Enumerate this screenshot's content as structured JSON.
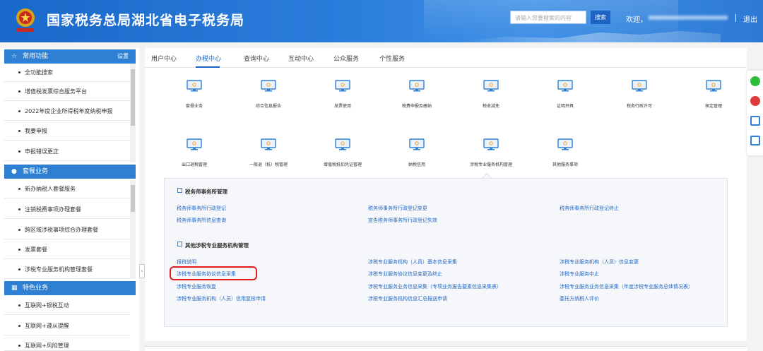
{
  "header": {
    "title": "国家税务总局湖北省电子税务局",
    "search_placeholder": "请输入您要搜索的内容",
    "search_button": "搜索",
    "welcome": "欢迎，",
    "logout": "退出"
  },
  "sidebar": {
    "sections": [
      {
        "title": "常用功能",
        "action": "设置",
        "items": [
          "全功能搜索",
          "增值税发票综合服务平台",
          "2022年度企业所得税年度纳税申报",
          "我要申报",
          "申报错误更正"
        ]
      },
      {
        "title": "套餐业务",
        "items": [
          "新办纳税人套餐服务",
          "注销税费事项办理套餐",
          "跨区域涉税事项综合办理套餐",
          "发票套餐",
          "涉税专业服务机构管理套餐"
        ]
      },
      {
        "title": "特色业务",
        "items": [
          "互联网+银税互动",
          "互联网+遵从提醒",
          "互联网+风险管理"
        ]
      }
    ]
  },
  "tabs": [
    "用户中心",
    "办税中心",
    "查询中心",
    "互动中心",
    "公众服务",
    "个性服务"
  ],
  "active_tab": "办税中心",
  "functions_row1": [
    "套餐业务",
    "综合信息报告",
    "发票使用",
    "税费申报及缴纳",
    "税收减免",
    "证明开具",
    "税务行政许可",
    "核定管理"
  ],
  "functions_row2": [
    "出口退税管理",
    "一般退（抵）税管理",
    "增值税抵扣凭证管理",
    "纳税信用",
    "涉税专业服务机构管理",
    "其他服务事项"
  ],
  "panel": {
    "group1": {
      "title": "税务师事务所管理",
      "links": [
        "税务师事务所行政登记",
        "税务师事务所行政登记变更",
        "税务师事务所行政登记终止",
        "税务师事务所信息查询",
        "宣告税务师事务所行政登记失效"
      ]
    },
    "group2": {
      "title": "其他涉税专业服务机构管理",
      "links": [
        "报税说明",
        "涉税专业服务机构（人员）基本信息采集",
        "涉税专业服务机构（人员）信息变更",
        "涉税专业服务协议信息采集",
        "涉税专业服务协议信息变更及终止",
        "涉税专业服务中止",
        "涉税专业服务恢复",
        "涉税专业服务业务信息采集（专项业务报告要素信息采集表）",
        "涉税专业服务业务信息采集（年度涉税专业服务总体情况表）",
        "涉税专业服务机构（人员）信用复核申请",
        "涉税专业服务机构信息汇总报送申请",
        "委托方纳税人评价"
      ]
    }
  },
  "colors": {
    "header_blue": "#2b7ddc",
    "link_blue": "#2468c4",
    "highlight_red": "#e01c1c"
  },
  "float_icons": [
    "wechat-icon",
    "weibo-icon",
    "app-icon",
    "app-icon"
  ]
}
